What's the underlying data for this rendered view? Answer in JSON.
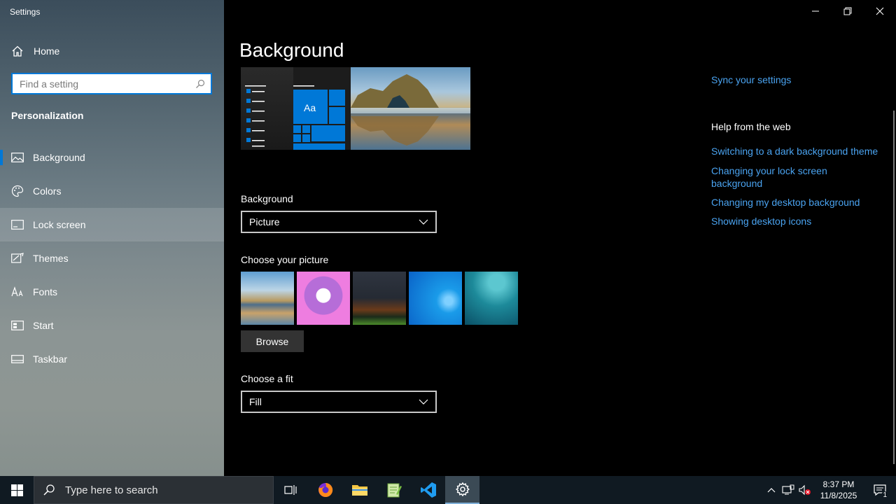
{
  "window": {
    "title": "Settings"
  },
  "sidebar": {
    "home_label": "Home",
    "search_placeholder": "Find a setting",
    "section_title": "Personalization",
    "items": [
      {
        "label": "Background",
        "icon": "picture-icon",
        "selected": true
      },
      {
        "label": "Colors",
        "icon": "palette-icon"
      },
      {
        "label": "Lock screen",
        "icon": "lock-screen-icon"
      },
      {
        "label": "Themes",
        "icon": "themes-icon"
      },
      {
        "label": "Fonts",
        "icon": "fonts-icon"
      },
      {
        "label": "Start",
        "icon": "start-icon"
      },
      {
        "label": "Taskbar",
        "icon": "taskbar-icon"
      }
    ]
  },
  "main": {
    "page_title": "Background",
    "preview_tile_text": "Aa",
    "background_label": "Background",
    "background_value": "Picture",
    "choose_picture_label": "Choose your picture",
    "browse_label": "Browse",
    "fit_label": "Choose a fit",
    "fit_value": "Fill"
  },
  "right_panel": {
    "sync_link": "Sync your settings",
    "help_title": "Help from the web",
    "links": [
      "Switching to a dark background theme",
      "Changing your lock screen",
      "background",
      "Changing my desktop background",
      "Showing desktop icons"
    ]
  },
  "taskbar": {
    "search_placeholder": "Type here to search",
    "time": "8:37 PM",
    "date": "11/8/2025",
    "notification_count": "1"
  },
  "colors": {
    "accent": "#0078d7",
    "link": "#4aa3f0",
    "taskbar": "#101a22"
  }
}
